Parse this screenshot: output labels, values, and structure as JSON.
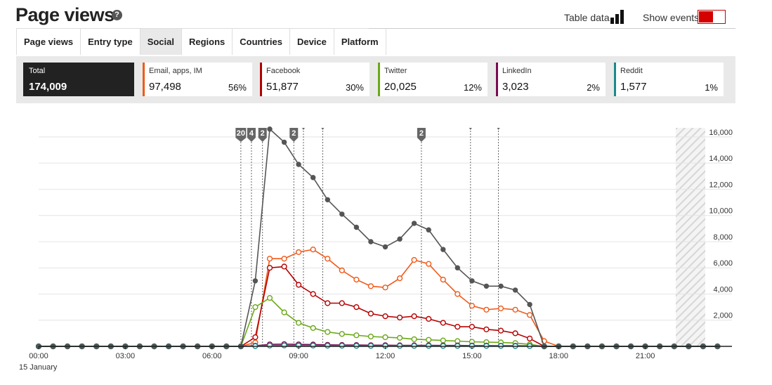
{
  "header": {
    "title": "Page views",
    "help_icon": "?",
    "table_data_label": "Table data",
    "show_events_label": "Show events",
    "show_events_on": true
  },
  "tabs": [
    "Page views",
    "Entry type",
    "Social",
    "Regions",
    "Countries",
    "Device",
    "Platform"
  ],
  "active_tab": "Social",
  "cards": [
    {
      "label": "Total",
      "value": "174,009",
      "pct": "",
      "color": "#222222"
    },
    {
      "label": "Email, apps, IM",
      "value": "97,498",
      "pct": "56%",
      "color": "#f05a1a"
    },
    {
      "label": "Facebook",
      "value": "51,877",
      "pct": "30%",
      "color": "#b50000"
    },
    {
      "label": "Twitter",
      "value": "20,025",
      "pct": "12%",
      "color": "#6aa818"
    },
    {
      "label": "LinkedIn",
      "value": "3,023",
      "pct": "2%",
      "color": "#7a0a50"
    },
    {
      "label": "Reddit",
      "value": "1,577",
      "pct": "1%",
      "color": "#1a8a8a"
    }
  ],
  "chart_data": {
    "type": "line",
    "x_start": "00:00",
    "x_step_minutes": 30,
    "x_ticks": [
      "00:00",
      "03:00",
      "06:00",
      "09:00",
      "12:00",
      "15:00",
      "18:00",
      "21:00"
    ],
    "x_date_label": "15 January",
    "y_ticks": [
      "2,000",
      "4,000",
      "6,000",
      "8,000",
      "10,000",
      "12,000",
      "14,000",
      "16,000"
    ],
    "ylim": [
      0,
      16800
    ],
    "grid": true,
    "events": [
      {
        "time": "07:00",
        "label": "20"
      },
      {
        "time": "07:22",
        "label": "4"
      },
      {
        "time": "07:45",
        "label": "2"
      },
      {
        "time": "08:50",
        "label": "2"
      },
      {
        "time": "09:10",
        "label": ""
      },
      {
        "time": "09:50",
        "label": ""
      },
      {
        "time": "13:15",
        "label": "2"
      },
      {
        "time": "14:57",
        "label": ""
      },
      {
        "time": "15:55",
        "label": ""
      }
    ],
    "series": [
      {
        "name": "Total",
        "color": "#555555",
        "values": [
          0,
          0,
          0,
          0,
          0,
          0,
          0,
          0,
          0,
          0,
          0,
          0,
          0,
          0,
          0,
          5000,
          16600,
          15600,
          13900,
          12900,
          11200,
          10100,
          9100,
          8000,
          7600,
          8200,
          9400,
          8900,
          7400,
          6000,
          5000,
          4600,
          4600,
          4300,
          3200,
          0,
          0,
          0,
          0,
          0,
          0,
          0,
          0,
          0,
          0,
          0,
          0,
          0
        ]
      },
      {
        "name": "Email, apps, IM",
        "color": "#f05a1a",
        "values": [
          0,
          0,
          0,
          0,
          0,
          0,
          0,
          0,
          0,
          0,
          0,
          0,
          0,
          0,
          0,
          300,
          6700,
          6700,
          7200,
          7400,
          6700,
          5800,
          5100,
          4600,
          4500,
          5200,
          6600,
          6300,
          5100,
          4000,
          3100,
          2800,
          2900,
          2800,
          2400,
          400,
          0,
          0,
          0,
          0,
          0,
          0,
          0,
          0,
          0,
          0,
          0,
          0
        ]
      },
      {
        "name": "Facebook",
        "color": "#b50000",
        "values": [
          0,
          0,
          0,
          0,
          0,
          0,
          0,
          0,
          0,
          0,
          0,
          0,
          0,
          0,
          0,
          700,
          6000,
          6100,
          4700,
          4000,
          3300,
          3300,
          3000,
          2500,
          2300,
          2200,
          2300,
          2100,
          1800,
          1500,
          1500,
          1300,
          1200,
          1000,
          600,
          0,
          0,
          0,
          0,
          0,
          0,
          0,
          0,
          0,
          0,
          0,
          0,
          0
        ]
      },
      {
        "name": "Twitter",
        "color": "#6aa818",
        "values": [
          0,
          0,
          0,
          0,
          0,
          0,
          0,
          0,
          0,
          0,
          0,
          0,
          0,
          0,
          0,
          3000,
          3700,
          2600,
          1800,
          1400,
          1100,
          950,
          850,
          750,
          700,
          650,
          550,
          500,
          450,
          400,
          350,
          320,
          300,
          250,
          150,
          0,
          0,
          0,
          0,
          0,
          0,
          0,
          0,
          0,
          0,
          0,
          0,
          0
        ]
      },
      {
        "name": "LinkedIn",
        "color": "#7a0a50",
        "values": [
          0,
          0,
          0,
          0,
          0,
          0,
          0,
          0,
          0,
          0,
          0,
          0,
          0,
          0,
          0,
          50,
          150,
          170,
          150,
          140,
          120,
          110,
          100,
          90,
          90,
          80,
          80,
          80,
          70,
          70,
          60,
          60,
          50,
          50,
          40,
          0,
          0,
          0,
          0,
          0,
          0,
          0,
          0,
          0,
          0,
          0,
          0,
          0
        ]
      },
      {
        "name": "Reddit",
        "color": "#1a8a8a",
        "values": [
          0,
          0,
          0,
          0,
          0,
          0,
          0,
          0,
          0,
          0,
          0,
          0,
          0,
          0,
          0,
          20,
          60,
          70,
          60,
          60,
          50,
          50,
          40,
          40,
          40,
          40,
          40,
          40,
          30,
          30,
          30,
          30,
          30,
          20,
          20,
          0,
          0,
          0,
          0,
          0,
          0,
          0,
          0,
          0,
          0,
          0,
          0,
          0
        ]
      }
    ]
  }
}
